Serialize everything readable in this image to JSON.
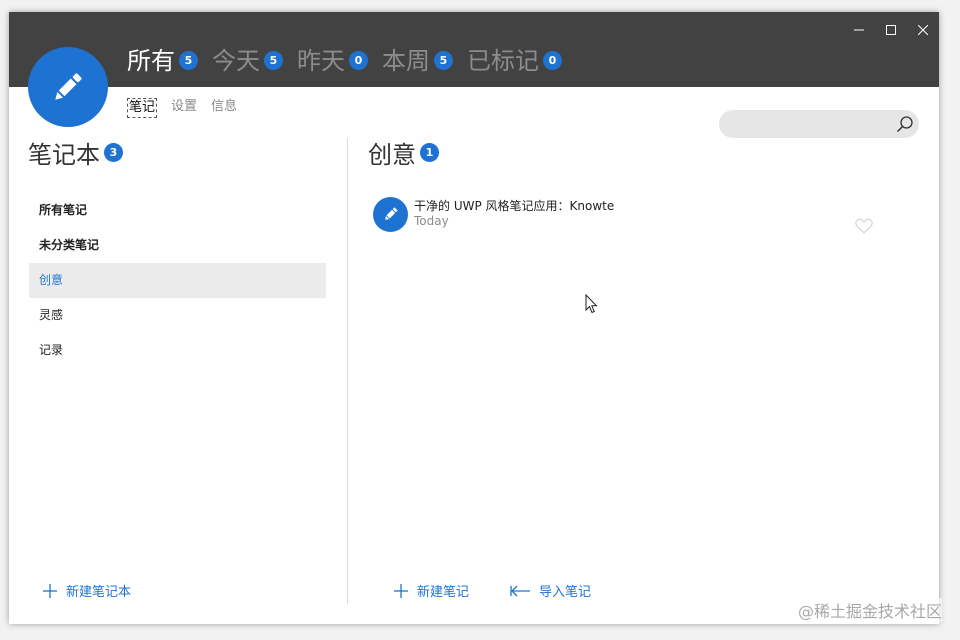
{
  "window": {
    "controls": [
      "minimize",
      "maximize",
      "close"
    ]
  },
  "top_tabs": [
    {
      "label": "所有",
      "count": "5",
      "active": true
    },
    {
      "label": "今天",
      "count": "5",
      "active": false
    },
    {
      "label": "昨天",
      "count": "0",
      "active": false
    },
    {
      "label": "本周",
      "count": "5",
      "active": false
    },
    {
      "label": "已标记",
      "count": "0",
      "active": false
    }
  ],
  "sub_tabs": [
    {
      "label": "笔记",
      "active": true
    },
    {
      "label": "设置",
      "active": false
    },
    {
      "label": "信息",
      "active": false
    }
  ],
  "search": {
    "placeholder": "",
    "value": ""
  },
  "notebooks": {
    "title": "笔记本",
    "count": "3",
    "items": [
      {
        "label": "所有笔记",
        "bold": true,
        "selected": false
      },
      {
        "label": "未分类笔记",
        "bold": true,
        "selected": false
      },
      {
        "label": "创意",
        "bold": false,
        "selected": true
      },
      {
        "label": "灵感",
        "bold": false,
        "selected": false
      },
      {
        "label": "记录",
        "bold": false,
        "selected": false
      }
    ],
    "new_label": "新建笔记本"
  },
  "notes": {
    "title": "创意",
    "count": "1",
    "items": [
      {
        "title": "干净的 UWP 风格笔记应用：Knowte",
        "date": "Today",
        "favorite": false
      }
    ],
    "new_label": "新建笔记",
    "import_label": "导入笔记"
  },
  "watermark": "@稀土掘金技术社区",
  "colors": {
    "accent": "#1e73d2",
    "titlebar": "#424242",
    "selected_bg": "#ebebeb"
  },
  "icons": {
    "app_logo": "pencil-icon",
    "search": "search-icon",
    "note": "pencil-icon",
    "favorite": "heart-icon",
    "add": "plus-icon",
    "import": "import-arrow-icon"
  }
}
